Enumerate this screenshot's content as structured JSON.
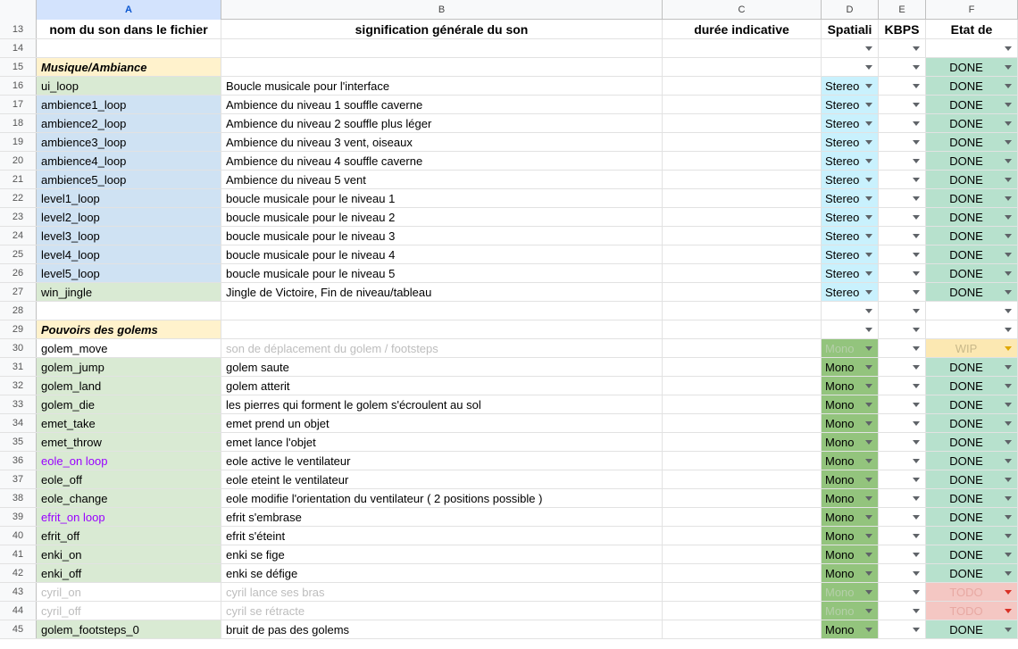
{
  "columns": [
    "",
    "A",
    "B",
    "C",
    "D",
    "E",
    "F"
  ],
  "selected_column": "A",
  "header_row": {
    "num": "13",
    "a": "nom du son dans le fichier",
    "b": "signification générale du son",
    "c": "durée indicative",
    "d": "Spatiali",
    "e": "KBPS",
    "f": "Etat de"
  },
  "colors": {
    "section": "#fff2cc",
    "blue": "#cfe2f3",
    "green": "#d9ead3",
    "stereo": "#c9f1fd",
    "mono": "#93c47d",
    "done": "#b7e1cd",
    "wip": "#fce8b2",
    "todo": "#f4c7c3",
    "purple": "#9900ff"
  },
  "rows": [
    {
      "num": "14",
      "a": "",
      "ac": "",
      "at": "",
      "b": "",
      "bt": "",
      "d": "",
      "dc": "",
      "dd": true,
      "e": true,
      "f": "",
      "fc": "",
      "fdd": true
    },
    {
      "num": "15",
      "a": "Musique/Ambiance",
      "ac": "section",
      "at": "section",
      "b": "",
      "bt": "",
      "d": "",
      "dc": "",
      "dd": true,
      "e": true,
      "f": "DONE",
      "fc": "done",
      "fdd": true
    },
    {
      "num": "16",
      "a": "ui_loop",
      "ac": "green",
      "at": "",
      "b": "Boucle musicale pour l'interface",
      "bt": "",
      "d": "Stereo",
      "dc": "stereo",
      "dd": true,
      "e": true,
      "f": "DONE",
      "fc": "done",
      "fdd": true
    },
    {
      "num": "17",
      "a": "ambience1_loop",
      "ac": "blue",
      "at": "",
      "b": "Ambience du niveau 1 souffle caverne",
      "bt": "",
      "d": "Stereo",
      "dc": "stereo",
      "dd": true,
      "e": true,
      "f": "DONE",
      "fc": "done",
      "fdd": true
    },
    {
      "num": "18",
      "a": "ambience2_loop",
      "ac": "blue",
      "at": "",
      "b": "Ambience du niveau 2 souffle plus léger",
      "bt": "",
      "d": "Stereo",
      "dc": "stereo",
      "dd": true,
      "e": true,
      "f": "DONE",
      "fc": "done",
      "fdd": true
    },
    {
      "num": "19",
      "a": "ambience3_loop",
      "ac": "blue",
      "at": "",
      "b": "Ambience du niveau 3 vent, oiseaux",
      "bt": "",
      "d": "Stereo",
      "dc": "stereo",
      "dd": true,
      "e": true,
      "f": "DONE",
      "fc": "done",
      "fdd": true
    },
    {
      "num": "20",
      "a": "ambience4_loop",
      "ac": "blue",
      "at": "",
      "b": "Ambience du niveau 4 souffle caverne",
      "bt": "",
      "d": "Stereo",
      "dc": "stereo",
      "dd": true,
      "e": true,
      "f": "DONE",
      "fc": "done",
      "fdd": true
    },
    {
      "num": "21",
      "a": "ambience5_loop",
      "ac": "blue",
      "at": "",
      "b": "Ambience du niveau 5 vent",
      "bt": "",
      "d": "Stereo",
      "dc": "stereo",
      "dd": true,
      "e": true,
      "f": "DONE",
      "fc": "done",
      "fdd": true
    },
    {
      "num": "22",
      "a": "level1_loop",
      "ac": "blue",
      "at": "",
      "b": "boucle musicale pour le niveau 1",
      "bt": "",
      "d": "Stereo",
      "dc": "stereo",
      "dd": true,
      "e": true,
      "f": "DONE",
      "fc": "done",
      "fdd": true
    },
    {
      "num": "23",
      "a": "level2_loop",
      "ac": "blue",
      "at": "",
      "b": "boucle musicale pour le niveau 2",
      "bt": "",
      "d": "Stereo",
      "dc": "stereo",
      "dd": true,
      "e": true,
      "f": "DONE",
      "fc": "done",
      "fdd": true
    },
    {
      "num": "24",
      "a": "level3_loop",
      "ac": "blue",
      "at": "",
      "b": "boucle musicale pour le niveau 3",
      "bt": "",
      "d": "Stereo",
      "dc": "stereo",
      "dd": true,
      "e": true,
      "f": "DONE",
      "fc": "done",
      "fdd": true
    },
    {
      "num": "25",
      "a": "level4_loop",
      "ac": "blue",
      "at": "",
      "b": "boucle musicale pour le niveau 4",
      "bt": "",
      "d": "Stereo",
      "dc": "stereo",
      "dd": true,
      "e": true,
      "f": "DONE",
      "fc": "done",
      "fdd": true
    },
    {
      "num": "26",
      "a": "level5_loop",
      "ac": "blue",
      "at": "",
      "b": "boucle musicale pour le niveau 5",
      "bt": "",
      "d": "Stereo",
      "dc": "stereo",
      "dd": true,
      "e": true,
      "f": "DONE",
      "fc": "done",
      "fdd": true
    },
    {
      "num": "27",
      "a": "win_jingle",
      "ac": "green",
      "at": "",
      "b": "Jingle de Victoire, Fin de niveau/tableau",
      "bt": "",
      "d": "Stereo",
      "dc": "stereo",
      "dd": true,
      "e": true,
      "f": "DONE",
      "fc": "done",
      "fdd": true
    },
    {
      "num": "28",
      "a": "",
      "ac": "",
      "at": "",
      "b": "",
      "bt": "",
      "d": "",
      "dc": "",
      "dd": true,
      "e": true,
      "f": "",
      "fc": "",
      "fdd": true
    },
    {
      "num": "29",
      "a": "Pouvoirs des golems",
      "ac": "section",
      "at": "section",
      "b": "",
      "bt": "",
      "d": "",
      "dc": "",
      "dd": true,
      "e": true,
      "f": "",
      "fc": "",
      "fdd": true
    },
    {
      "num": "30",
      "a": "golem_move",
      "ac": "",
      "at": "",
      "b": "son de déplacement du golem / footsteps",
      "bt": "ghost",
      "d": "Mono",
      "dc": "mono",
      "dtext": "ghost",
      "dd": true,
      "e": true,
      "f": "WIP",
      "fc": "wip",
      "ftext": "ghost",
      "fdd": true
    },
    {
      "num": "31",
      "a": "golem_jump",
      "ac": "green",
      "at": "",
      "b": "golem saute",
      "bt": "",
      "d": "Mono",
      "dc": "mono",
      "dd": true,
      "e": true,
      "f": "DONE",
      "fc": "done",
      "fdd": true
    },
    {
      "num": "32",
      "a": "golem_land",
      "ac": "green",
      "at": "",
      "b": "golem atterit",
      "bt": "",
      "d": "Mono",
      "dc": "mono",
      "dd": true,
      "e": true,
      "f": "DONE",
      "fc": "done",
      "fdd": true
    },
    {
      "num": "33",
      "a": "golem_die",
      "ac": "green",
      "at": "",
      "b": "les pierres qui forment le golem s'écroulent au sol",
      "bt": "",
      "d": "Mono",
      "dc": "mono",
      "dd": true,
      "e": true,
      "f": "DONE",
      "fc": "done",
      "fdd": true
    },
    {
      "num": "34",
      "a": "emet_take",
      "ac": "green",
      "at": "",
      "b": "emet prend un objet",
      "bt": "",
      "d": "Mono",
      "dc": "mono",
      "dd": true,
      "e": true,
      "f": "DONE",
      "fc": "done",
      "fdd": true
    },
    {
      "num": "35",
      "a": "emet_throw",
      "ac": "green",
      "at": "",
      "b": "emet lance l'objet",
      "bt": "",
      "d": "Mono",
      "dc": "mono",
      "dd": true,
      "e": true,
      "f": "DONE",
      "fc": "done",
      "fdd": true
    },
    {
      "num": "36",
      "a": "eole_on loop",
      "ac": "green",
      "at": "purple",
      "b": "eole active le ventilateur",
      "bt": "",
      "d": "Mono",
      "dc": "mono",
      "dd": true,
      "e": true,
      "f": "DONE",
      "fc": "done",
      "fdd": true
    },
    {
      "num": "37",
      "a": "eole_off",
      "ac": "green",
      "at": "",
      "b": "eole eteint le ventilateur",
      "bt": "",
      "d": "Mono",
      "dc": "mono",
      "dd": true,
      "e": true,
      "f": "DONE",
      "fc": "done",
      "fdd": true
    },
    {
      "num": "38",
      "a": "eole_change",
      "ac": "green",
      "at": "",
      "b": "eole modifie l'orientation du ventilateur ( 2 positions possible )",
      "bt": "",
      "d": "Mono",
      "dc": "mono",
      "dd": true,
      "e": true,
      "f": "DONE",
      "fc": "done",
      "fdd": true
    },
    {
      "num": "39",
      "a": "efrit_on loop",
      "ac": "green",
      "at": "purple",
      "b": "efrit s'embrase",
      "bt": "",
      "d": "Mono",
      "dc": "mono",
      "dd": true,
      "e": true,
      "f": "DONE",
      "fc": "done",
      "fdd": true
    },
    {
      "num": "40",
      "a": "efrit_off",
      "ac": "green",
      "at": "",
      "b": "efrit s'éteint",
      "bt": "",
      "d": "Mono",
      "dc": "mono",
      "dd": true,
      "e": true,
      "f": "DONE",
      "fc": "done",
      "fdd": true
    },
    {
      "num": "41",
      "a": "enki_on",
      "ac": "green",
      "at": "",
      "b": "enki se fige",
      "bt": "",
      "d": "Mono",
      "dc": "mono",
      "dd": true,
      "e": true,
      "f": "DONE",
      "fc": "done",
      "fdd": true
    },
    {
      "num": "42",
      "a": "enki_off",
      "ac": "green",
      "at": "",
      "b": "enki se défige",
      "bt": "",
      "d": "Mono",
      "dc": "mono",
      "dd": true,
      "e": true,
      "f": "DONE",
      "fc": "done",
      "fdd": true
    },
    {
      "num": "43",
      "a": "cyril_on",
      "ac": "",
      "at": "ghost",
      "b": "cyril lance ses bras",
      "bt": "ghost",
      "d": "Mono",
      "dc": "mono",
      "dtext": "ghost",
      "dd": true,
      "e": true,
      "f": "TODO",
      "fc": "todo",
      "ftext": "ghost",
      "fdd": true
    },
    {
      "num": "44",
      "a": "cyril_off",
      "ac": "",
      "at": "ghost",
      "b": "cyril se rétracte",
      "bt": "ghost",
      "d": "Mono",
      "dc": "mono",
      "dtext": "ghost",
      "dd": true,
      "e": true,
      "f": "TODO",
      "fc": "todo",
      "ftext": "ghost",
      "fdd": true
    },
    {
      "num": "45",
      "a": "golem_footsteps_0",
      "ac": "green",
      "at": "",
      "b": "bruit de pas des golems",
      "bt": "",
      "d": "Mono",
      "dc": "mono",
      "dd": true,
      "e": true,
      "f": "DONE",
      "fc": "done",
      "fdd": true
    }
  ]
}
